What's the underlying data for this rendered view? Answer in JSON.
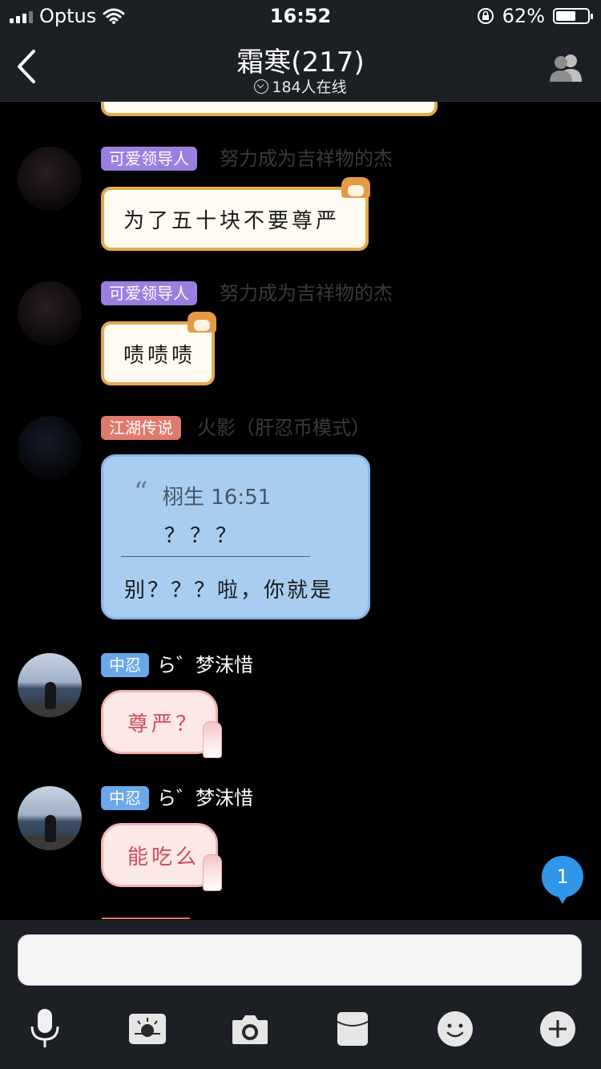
{
  "status": {
    "carrier": "Optus",
    "time": "16:52",
    "battery": "62%",
    "battery_level": 0.62
  },
  "header": {
    "title": "霜寒(217)",
    "online": "184人在线"
  },
  "messages": [
    {
      "role": "江湖传说",
      "nick": "火影（肝忍币模式）"
    },
    {
      "role": "可爱领导人",
      "nick": "努力成为吉祥物的杰",
      "text": "为了五十块不要尊严"
    },
    {
      "role": "可爱领导人",
      "nick": "努力成为吉祥物的杰",
      "text": "啧啧啧"
    },
    {
      "role": "江湖传说",
      "nick": "火影（肝忍币模式）",
      "quote_author_time": "栩生 16:51",
      "quote_text": "？？？",
      "text": "别？？？啦，你就是"
    },
    {
      "role": "中忍",
      "nick": "ら゛梦沫惜",
      "text": "尊严？"
    },
    {
      "role": "中忍",
      "nick": "ら゛梦沫惜",
      "text": "能吃么"
    }
  ],
  "unread_count": "1",
  "input": {
    "value": "",
    "placeholder": ""
  },
  "toolbar": [
    "microphone-icon",
    "image-icon",
    "camera-icon",
    "red-packet-icon",
    "emoji-icon",
    "plus-icon"
  ]
}
